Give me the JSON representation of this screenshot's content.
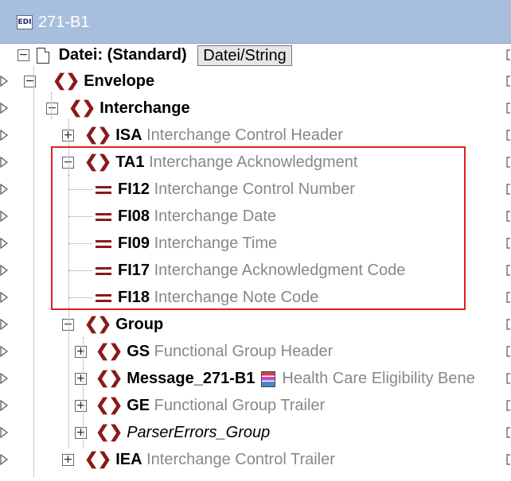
{
  "window": {
    "icon": "edi-icon",
    "icon_text": "EDI",
    "title": "271-B1"
  },
  "file_row": {
    "label": "Datei: (Standard)",
    "button": "Datei/String"
  },
  "tree": [
    {
      "id": "envelope",
      "name": "Envelope",
      "desc": "",
      "kind": "group"
    },
    {
      "id": "interchange",
      "name": "Interchange",
      "desc": "",
      "kind": "group"
    },
    {
      "id": "isa",
      "name": "ISA",
      "desc": "Interchange Control Header",
      "kind": "segment"
    },
    {
      "id": "ta1",
      "name": "TA1",
      "desc": "Interchange Acknowledgment",
      "kind": "segment"
    },
    {
      "id": "fi12",
      "name": "FI12",
      "desc": "Interchange Control Number",
      "kind": "field"
    },
    {
      "id": "fi08",
      "name": "FI08",
      "desc": "Interchange Date",
      "kind": "field"
    },
    {
      "id": "fi09",
      "name": "FI09",
      "desc": "Interchange Time",
      "kind": "field"
    },
    {
      "id": "fi17",
      "name": "FI17",
      "desc": "Interchange Acknowledgment Code",
      "kind": "field"
    },
    {
      "id": "fi18",
      "name": "FI18",
      "desc": "Interchange Note Code",
      "kind": "field"
    },
    {
      "id": "group",
      "name": "Group",
      "desc": "",
      "kind": "group"
    },
    {
      "id": "gs",
      "name": "GS",
      "desc": "Functional Group Header",
      "kind": "segment"
    },
    {
      "id": "message",
      "name": "Message_271-B1",
      "desc": "Health Care Eligibility Bene",
      "kind": "message"
    },
    {
      "id": "ge",
      "name": "GE",
      "desc": "Functional Group Trailer",
      "kind": "segment"
    },
    {
      "id": "parsererrors",
      "name": "ParserErrors_Group",
      "desc": "",
      "kind": "italic"
    },
    {
      "id": "iea",
      "name": "IEA",
      "desc": "Interchange Control Trailer",
      "kind": "segment"
    }
  ],
  "expand_symbols": {
    "collapsed": "+",
    "expanded": "−"
  },
  "brace_symbol": "❮❯",
  "colors": {
    "titlebar": "#a7bfdc",
    "brace": "#8a1a1a",
    "highlight": "#e02020",
    "desc": "#888888"
  }
}
